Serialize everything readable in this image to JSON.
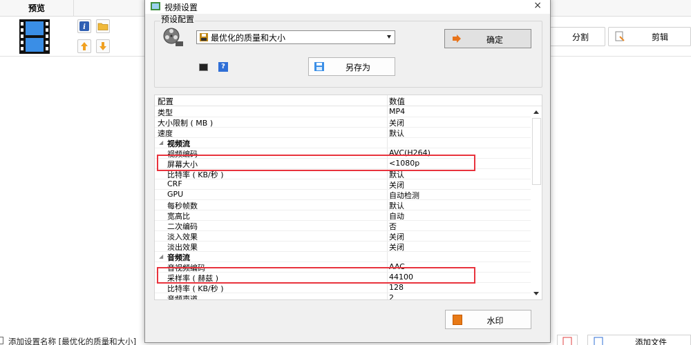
{
  "background": {
    "preview_header": "预览",
    "buttons": {
      "split": "分割",
      "edit": "剪辑",
      "add_file": "添加文件"
    },
    "bottom_text": "添加设置名称 [最优化的质量和大小]"
  },
  "dialog": {
    "title": "视频设置",
    "close_glyph": "×",
    "preset_group_label": "预设配置",
    "preset_value": "最优化的质量和大小",
    "ok_label": "确定",
    "save_as_label": "另存为",
    "help_glyph": "?",
    "watermark_label": "水印",
    "grid": {
      "col_key": "配置",
      "col_value": "数值",
      "rows": [
        {
          "type": "item",
          "key": "类型",
          "value": "MP4"
        },
        {
          "type": "item",
          "key": "大小限制 ( MB )",
          "value": "关闭"
        },
        {
          "type": "item",
          "key": "速度",
          "value": "默认"
        },
        {
          "type": "category",
          "key": "视频流",
          "value": ""
        },
        {
          "type": "sub",
          "key": "视频编码",
          "value": "AVC(H264)"
        },
        {
          "type": "sub",
          "key": "屏幕大小",
          "value": "<1080p"
        },
        {
          "type": "sub",
          "key": "比特率 ( KB/秒 )",
          "value": "默认"
        },
        {
          "type": "sub",
          "key": "CRF",
          "value": "关闭"
        },
        {
          "type": "sub",
          "key": "GPU",
          "value": "自动检测"
        },
        {
          "type": "sub",
          "key": "每秒帧数",
          "value": "默认"
        },
        {
          "type": "sub",
          "key": "宽高比",
          "value": "自动"
        },
        {
          "type": "sub",
          "key": "二次编码",
          "value": "否"
        },
        {
          "type": "sub",
          "key": "淡入效果",
          "value": "关闭"
        },
        {
          "type": "sub",
          "key": "淡出效果",
          "value": "关闭"
        },
        {
          "type": "category",
          "key": "音频流",
          "value": ""
        },
        {
          "type": "sub",
          "key": "音视频编码",
          "value": "AAC"
        },
        {
          "type": "sub",
          "key": "采样率 ( 赫兹 )",
          "value": "44100"
        },
        {
          "type": "sub",
          "key": "比特率 ( KB/秒 )",
          "value": "128"
        },
        {
          "type": "sub",
          "key": "音频声道",
          "value": "2"
        }
      ]
    }
  },
  "colors": {
    "highlight": "#e8323c",
    "help_icon": "#2f6fd6",
    "ok_arrow": "#e8741b"
  }
}
